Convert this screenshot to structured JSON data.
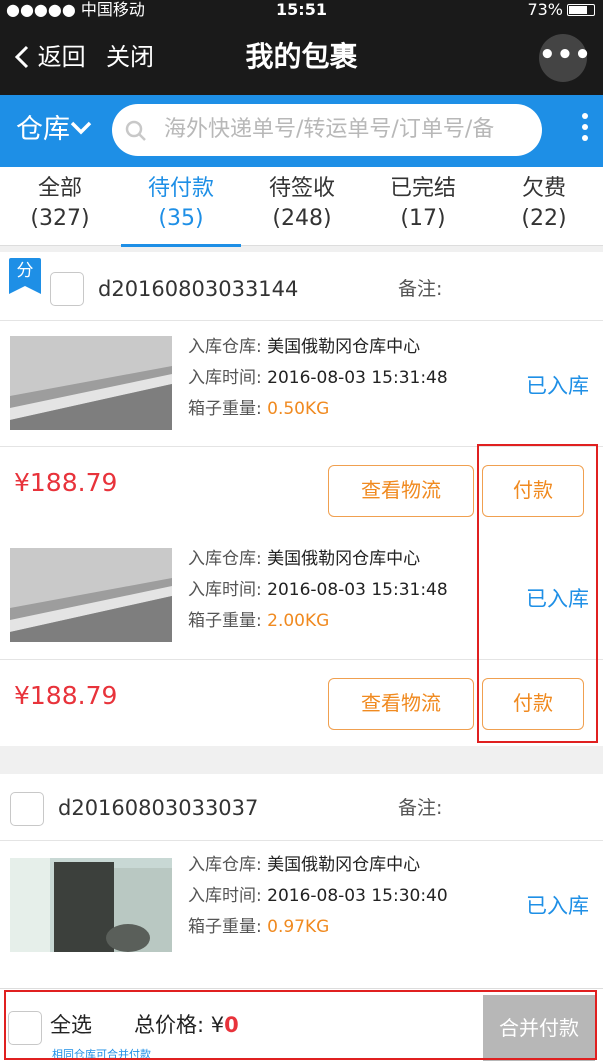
{
  "status_bar": {
    "carrier": "●●●●● 中国移动",
    "time": "15:51",
    "battery": "73%"
  },
  "nav": {
    "back_label": "返回",
    "close_label": "关闭",
    "title": "我的包裹",
    "more_label": "•••"
  },
  "search": {
    "warehouse_label": "仓库",
    "placeholder": "海外快递单号/转运单号/订单号/备"
  },
  "tabs": [
    {
      "label": "全部",
      "count": "(327)",
      "active": false
    },
    {
      "label": "待付款",
      "count": "(35)",
      "active": true
    },
    {
      "label": "待签收",
      "count": "(248)",
      "active": false
    },
    {
      "label": "已完结",
      "count": "(17)",
      "active": false
    },
    {
      "label": "欠费",
      "count": "(22)",
      "active": false
    }
  ],
  "orders": [
    {
      "tag": "分",
      "order_no": "d20160803033144",
      "memo_label": "备注:",
      "packages": [
        {
          "warehouse_label": "入库仓库:",
          "warehouse": "美国俄勒冈仓库中心",
          "time_label": "入库时间:",
          "time": "2016-08-03 15:31:48",
          "weight_label": "箱子重量:",
          "weight": "0.50KG",
          "status": "已入库",
          "price": "¥188.79",
          "logistics_btn": "查看物流",
          "pay_btn": "付款"
        },
        {
          "warehouse_label": "入库仓库:",
          "warehouse": "美国俄勒冈仓库中心",
          "time_label": "入库时间:",
          "time": "2016-08-03 15:31:48",
          "weight_label": "箱子重量:",
          "weight": "2.00KG",
          "status": "已入库",
          "price": "¥188.79",
          "logistics_btn": "查看物流",
          "pay_btn": "付款"
        }
      ]
    },
    {
      "order_no": "d20160803033037",
      "memo_label": "备注:",
      "packages": [
        {
          "warehouse_label": "入库仓库:",
          "warehouse": "美国俄勒冈仓库中心",
          "time_label": "入库时间:",
          "time": "2016-08-03 15:30:40",
          "weight_label": "箱子重量:",
          "weight": "0.97KG",
          "status": "已入库"
        }
      ]
    }
  ],
  "bottom_bar": {
    "select_all": "全选",
    "total_label": "总价格:",
    "currency": "¥",
    "total_value": "0",
    "merge_pay": "合并付款",
    "hint": "相同仓库可合并付款"
  },
  "colors": {
    "accent": "#1e8fe6",
    "price": "#e8333b",
    "orange": "#f08a20",
    "highlight": "#e02020"
  }
}
